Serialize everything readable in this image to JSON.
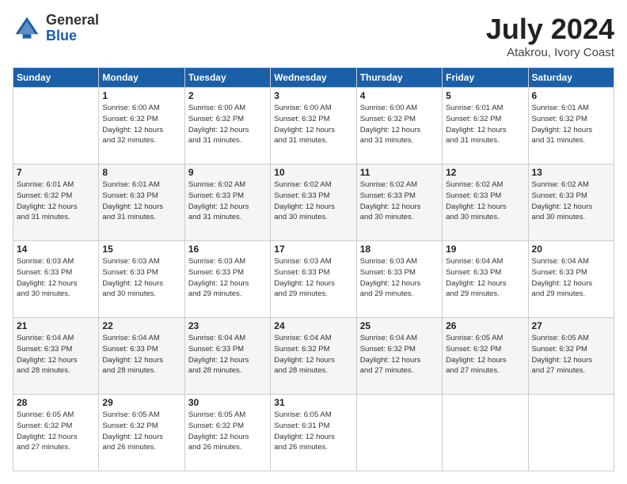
{
  "logo": {
    "general": "General",
    "blue": "Blue"
  },
  "title": {
    "month_year": "July 2024",
    "location": "Atakrou, Ivory Coast"
  },
  "weekdays": [
    "Sunday",
    "Monday",
    "Tuesday",
    "Wednesday",
    "Thursday",
    "Friday",
    "Saturday"
  ],
  "weeks": [
    [
      {
        "day": "",
        "info": ""
      },
      {
        "day": "1",
        "info": "Sunrise: 6:00 AM\nSunset: 6:32 PM\nDaylight: 12 hours\nand 32 minutes."
      },
      {
        "day": "2",
        "info": "Sunrise: 6:00 AM\nSunset: 6:32 PM\nDaylight: 12 hours\nand 31 minutes."
      },
      {
        "day": "3",
        "info": "Sunrise: 6:00 AM\nSunset: 6:32 PM\nDaylight: 12 hours\nand 31 minutes."
      },
      {
        "day": "4",
        "info": "Sunrise: 6:00 AM\nSunset: 6:32 PM\nDaylight: 12 hours\nand 31 minutes."
      },
      {
        "day": "5",
        "info": "Sunrise: 6:01 AM\nSunset: 6:32 PM\nDaylight: 12 hours\nand 31 minutes."
      },
      {
        "day": "6",
        "info": "Sunrise: 6:01 AM\nSunset: 6:32 PM\nDaylight: 12 hours\nand 31 minutes."
      }
    ],
    [
      {
        "day": "7",
        "info": "Sunrise: 6:01 AM\nSunset: 6:32 PM\nDaylight: 12 hours\nand 31 minutes."
      },
      {
        "day": "8",
        "info": "Sunrise: 6:01 AM\nSunset: 6:33 PM\nDaylight: 12 hours\nand 31 minutes."
      },
      {
        "day": "9",
        "info": "Sunrise: 6:02 AM\nSunset: 6:33 PM\nDaylight: 12 hours\nand 31 minutes."
      },
      {
        "day": "10",
        "info": "Sunrise: 6:02 AM\nSunset: 6:33 PM\nDaylight: 12 hours\nand 30 minutes."
      },
      {
        "day": "11",
        "info": "Sunrise: 6:02 AM\nSunset: 6:33 PM\nDaylight: 12 hours\nand 30 minutes."
      },
      {
        "day": "12",
        "info": "Sunrise: 6:02 AM\nSunset: 6:33 PM\nDaylight: 12 hours\nand 30 minutes."
      },
      {
        "day": "13",
        "info": "Sunrise: 6:02 AM\nSunset: 6:33 PM\nDaylight: 12 hours\nand 30 minutes."
      }
    ],
    [
      {
        "day": "14",
        "info": "Sunrise: 6:03 AM\nSunset: 6:33 PM\nDaylight: 12 hours\nand 30 minutes."
      },
      {
        "day": "15",
        "info": "Sunrise: 6:03 AM\nSunset: 6:33 PM\nDaylight: 12 hours\nand 30 minutes."
      },
      {
        "day": "16",
        "info": "Sunrise: 6:03 AM\nSunset: 6:33 PM\nDaylight: 12 hours\nand 29 minutes."
      },
      {
        "day": "17",
        "info": "Sunrise: 6:03 AM\nSunset: 6:33 PM\nDaylight: 12 hours\nand 29 minutes."
      },
      {
        "day": "18",
        "info": "Sunrise: 6:03 AM\nSunset: 6:33 PM\nDaylight: 12 hours\nand 29 minutes."
      },
      {
        "day": "19",
        "info": "Sunrise: 6:04 AM\nSunset: 6:33 PM\nDaylight: 12 hours\nand 29 minutes."
      },
      {
        "day": "20",
        "info": "Sunrise: 6:04 AM\nSunset: 6:33 PM\nDaylight: 12 hours\nand 29 minutes."
      }
    ],
    [
      {
        "day": "21",
        "info": "Sunrise: 6:04 AM\nSunset: 6:33 PM\nDaylight: 12 hours\nand 28 minutes."
      },
      {
        "day": "22",
        "info": "Sunrise: 6:04 AM\nSunset: 6:33 PM\nDaylight: 12 hours\nand 28 minutes."
      },
      {
        "day": "23",
        "info": "Sunrise: 6:04 AM\nSunset: 6:33 PM\nDaylight: 12 hours\nand 28 minutes."
      },
      {
        "day": "24",
        "info": "Sunrise: 6:04 AM\nSunset: 6:32 PM\nDaylight: 12 hours\nand 28 minutes."
      },
      {
        "day": "25",
        "info": "Sunrise: 6:04 AM\nSunset: 6:32 PM\nDaylight: 12 hours\nand 27 minutes."
      },
      {
        "day": "26",
        "info": "Sunrise: 6:05 AM\nSunset: 6:32 PM\nDaylight: 12 hours\nand 27 minutes."
      },
      {
        "day": "27",
        "info": "Sunrise: 6:05 AM\nSunset: 6:32 PM\nDaylight: 12 hours\nand 27 minutes."
      }
    ],
    [
      {
        "day": "28",
        "info": "Sunrise: 6:05 AM\nSunset: 6:32 PM\nDaylight: 12 hours\nand 27 minutes."
      },
      {
        "day": "29",
        "info": "Sunrise: 6:05 AM\nSunset: 6:32 PM\nDaylight: 12 hours\nand 26 minutes."
      },
      {
        "day": "30",
        "info": "Sunrise: 6:05 AM\nSunset: 6:32 PM\nDaylight: 12 hours\nand 26 minutes."
      },
      {
        "day": "31",
        "info": "Sunrise: 6:05 AM\nSunset: 6:31 PM\nDaylight: 12 hours\nand 26 minutes."
      },
      {
        "day": "",
        "info": ""
      },
      {
        "day": "",
        "info": ""
      },
      {
        "day": "",
        "info": ""
      }
    ]
  ]
}
